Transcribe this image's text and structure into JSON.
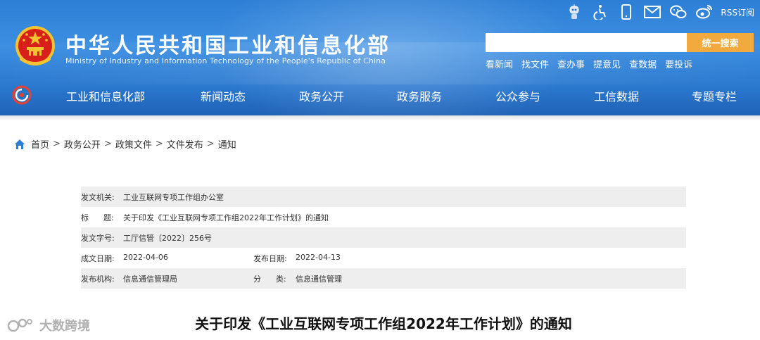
{
  "header": {
    "title": "中华人民共和国工业和信息化部",
    "subtitle": "Ministry of Industry and Information Technology of the People's Republic of China",
    "top_icons": [
      "robot-icon",
      "accessibility-icon",
      "mobile-icon",
      "mail-icon",
      "wechat-icon",
      "weibo-icon"
    ],
    "rss_label": "RSS订阅",
    "search": {
      "value": "",
      "placeholder": "",
      "button_label": "统一搜索"
    },
    "quick_links": [
      "看新闻",
      "找文件",
      "查办事",
      "提意见",
      "查数据",
      "要投诉"
    ],
    "nav": [
      "工业和信息化部",
      "新闻动态",
      "政务公开",
      "政务服务",
      "公众参与",
      "工信数据",
      "专题专栏"
    ],
    "colors": {
      "header_blue": "#2d7fd6",
      "search_orange": "#f2a93d"
    }
  },
  "breadcrumb": [
    "首页",
    "政务公开",
    "政策文件",
    "文件发布",
    "通知"
  ],
  "info": {
    "issuer_label": "发文机关:",
    "issuer": "工业互联网专项工作组办公室",
    "title_label": "标      题:",
    "title": "关于印发《工业互联网专项工作组2022年工作计划》的通知",
    "doc_no_label": "发文字号:",
    "doc_no": "工厅信管〔2022〕256号",
    "written_date_label": "成文日期:",
    "written_date": "2022-04-06",
    "publish_date_label": "发布日期:",
    "publish_date": "2022-04-13",
    "agency_label": "发布机构:",
    "agency": "信息通信管理局",
    "category_label": "分      类:",
    "category": "信息通信管理"
  },
  "article_title": "关于印发《工业互联网专项工作组2022年工作计划》的通知",
  "watermark": "大数跨境"
}
